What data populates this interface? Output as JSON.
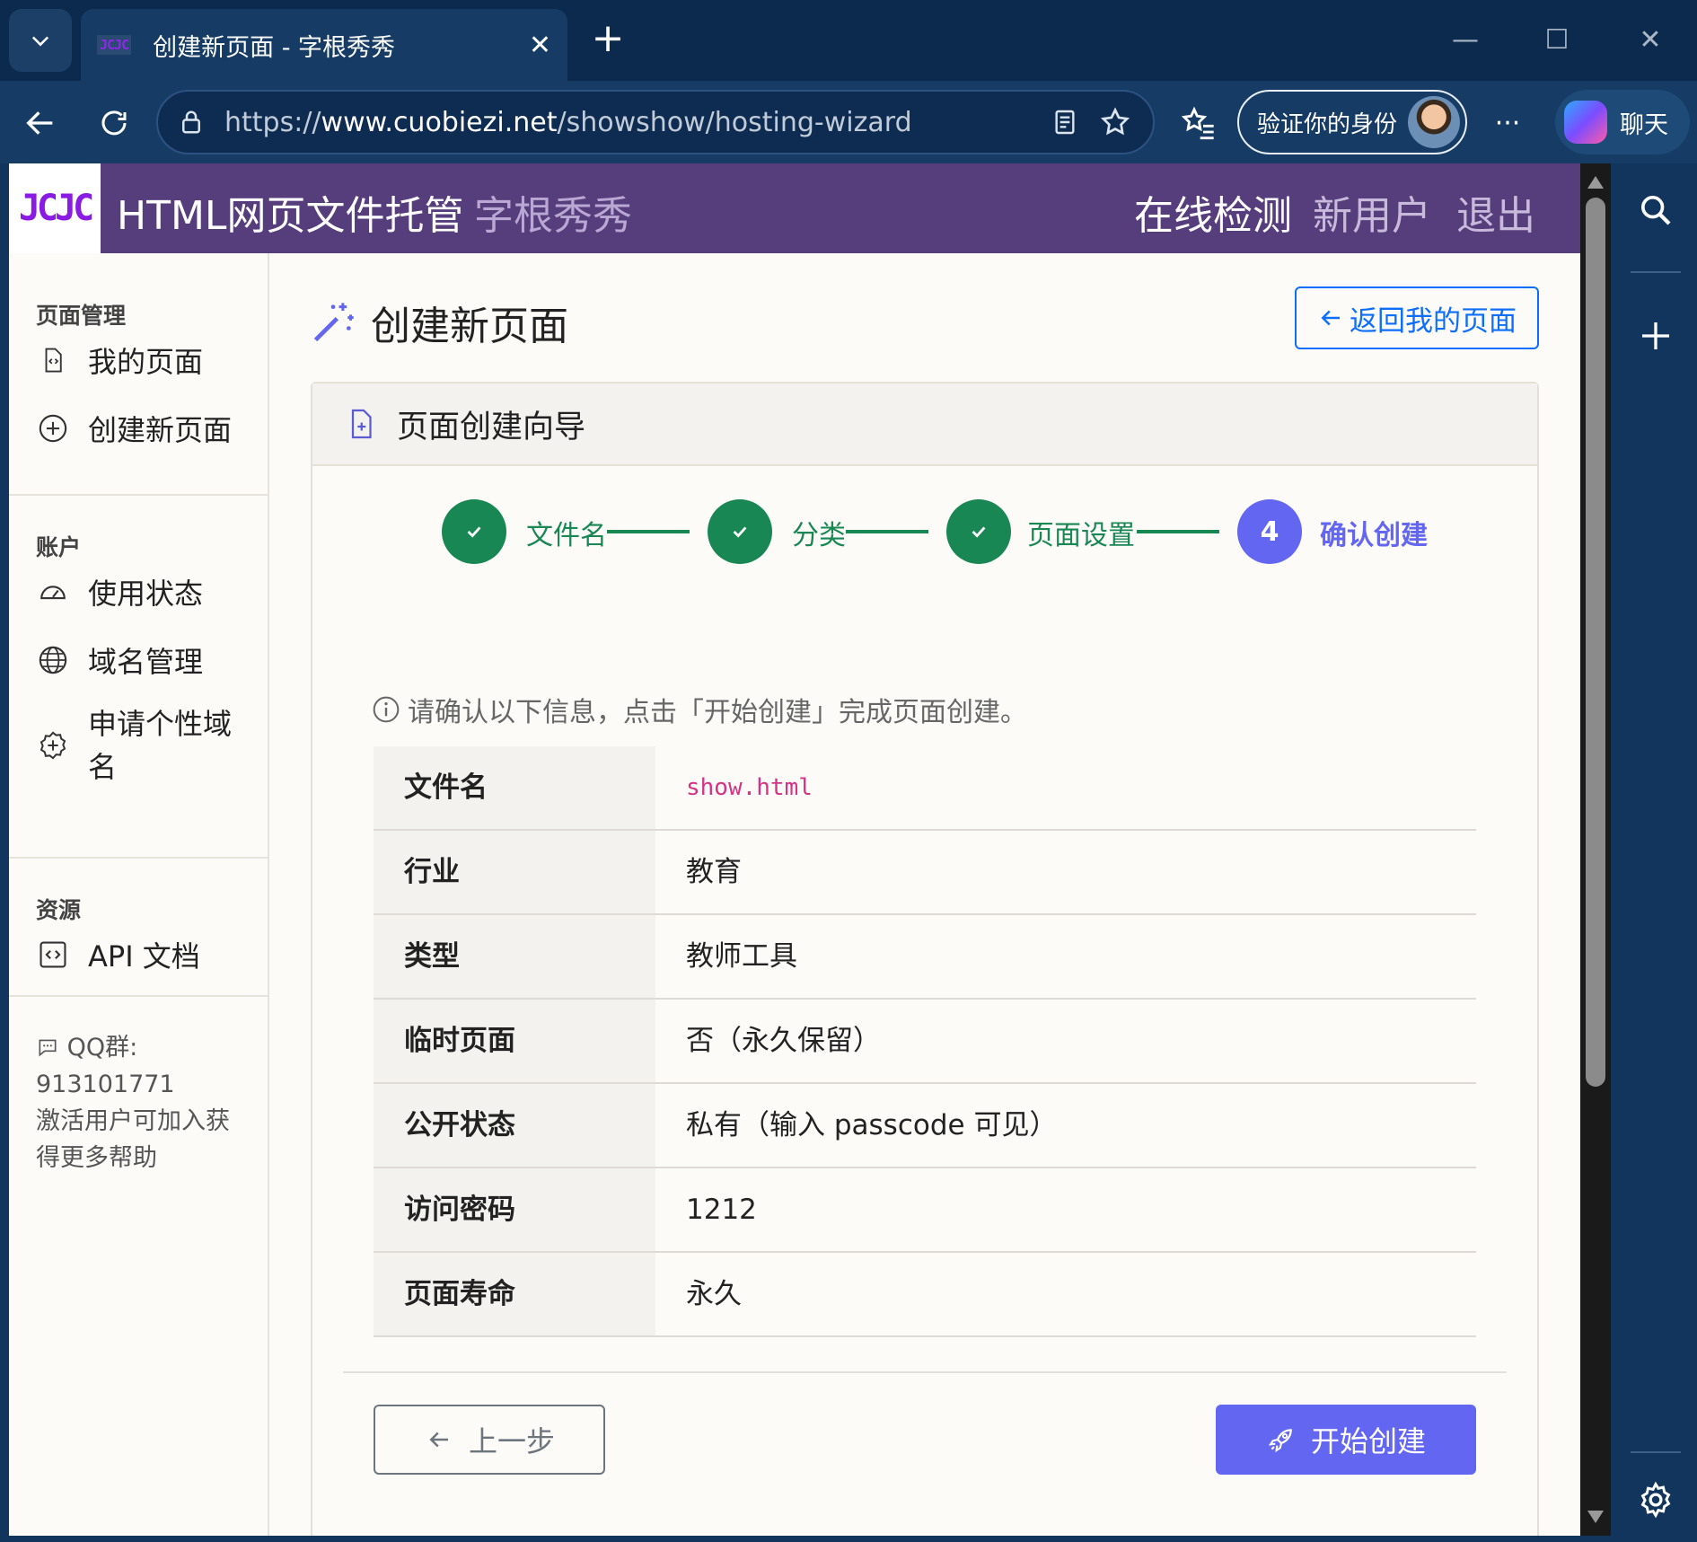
{
  "browser": {
    "tab_title": "创建新页面 - 字根秀秀",
    "tab_favicon_text": "JCJC",
    "url_prefix": "https://",
    "url_domain": "www.cuobiezi.net",
    "url_path": "/showshow/hosting-wizard",
    "verify_label": "验证你的身份",
    "chat_label": "聊天"
  },
  "header": {
    "logo_text": "JCJC",
    "title": "HTML网页文件托管",
    "subtitle": "字根秀秀",
    "nav": [
      "在线检测",
      "新用户",
      "退出"
    ]
  },
  "sidebar": {
    "sections": [
      {
        "title": "页面管理",
        "items": [
          "我的页面",
          "创建新页面"
        ]
      },
      {
        "title": "账户",
        "items": [
          "使用状态",
          "域名管理",
          "申请个性域名"
        ]
      },
      {
        "title": "资源",
        "items": [
          "API 文档"
        ]
      }
    ],
    "qq_line1": "QQ群:",
    "qq_number": "913101771",
    "qq_note": "激活用户可加入获得更多帮助"
  },
  "main": {
    "title": "创建新页面",
    "back_button": "返回我的页面",
    "card_title": "页面创建向导",
    "steps": [
      {
        "label": "文件名",
        "state": "done"
      },
      {
        "label": "分类",
        "state": "done"
      },
      {
        "label": "页面设置",
        "state": "done"
      },
      {
        "label": "确认创建",
        "state": "active",
        "number": "4"
      }
    ],
    "info_note": "请确认以下信息，点击「开始创建」完成页面创建。",
    "summary": [
      {
        "key": "文件名",
        "value": "show.html"
      },
      {
        "key": "行业",
        "value": "教育"
      },
      {
        "key": "类型",
        "value": "教师工具"
      },
      {
        "key": "临时页面",
        "value": "否（永久保留）"
      },
      {
        "key": "公开状态",
        "value": "私有（输入 passcode 可见）"
      },
      {
        "key": "访问密码",
        "value": "1212"
      },
      {
        "key": "页面寿命",
        "value": "永久"
      }
    ],
    "prev_button": "上一步",
    "start_button": "开始创建"
  },
  "colors": {
    "header_bg": "#563d7c",
    "step_done": "#198754",
    "step_active": "#6366f1",
    "primary_blue": "#0d6efd",
    "code_pink": "#d63384"
  }
}
